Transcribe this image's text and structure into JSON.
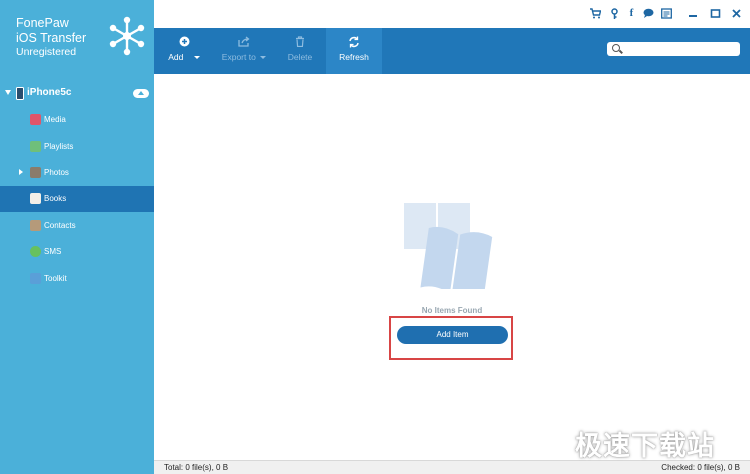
{
  "app": {
    "name_line1": "FonePaw",
    "name_line2": "iOS Transfer",
    "status": "Unregistered"
  },
  "device": {
    "name": "iPhone5c"
  },
  "sidebar": {
    "items": [
      {
        "label": "Media",
        "icon": "music-icon",
        "color": "#e0556a"
      },
      {
        "label": "Playlists",
        "icon": "playlist-icon",
        "color": "#6fbf7a"
      },
      {
        "label": "Photos",
        "icon": "photos-icon",
        "color": "#8a7c6b"
      },
      {
        "label": "Books",
        "icon": "book-icon",
        "color": "#f2efe8"
      },
      {
        "label": "Contacts",
        "icon": "contacts-icon",
        "color": "#b59a7a"
      },
      {
        "label": "SMS",
        "icon": "sms-icon",
        "color": "#67c15e"
      },
      {
        "label": "Toolkit",
        "icon": "toolkit-icon",
        "color": "#5a9fd8"
      }
    ],
    "active": "Books"
  },
  "titlebar": {
    "icons": [
      "cart-icon",
      "key-icon",
      "facebook-icon",
      "chat-icon",
      "feedback-icon",
      "minimize-icon",
      "maximize-icon",
      "close-icon"
    ]
  },
  "toolbar": {
    "add": "Add",
    "export": "Export to",
    "delete": "Delete",
    "refresh": "Refresh"
  },
  "search": {
    "placeholder": ""
  },
  "content": {
    "empty_message": "No Items Found",
    "add_item": "Add Item"
  },
  "status": {
    "total": "Total: 0 file(s), 0 B",
    "checked": "Checked: 0 file(s), 0 B"
  },
  "watermark": "极速下载站",
  "colors": {
    "sidebar": "#4bb0d9",
    "toolbar": "#2077b8",
    "active": "#1f74b3",
    "highlight": "#d84545"
  }
}
